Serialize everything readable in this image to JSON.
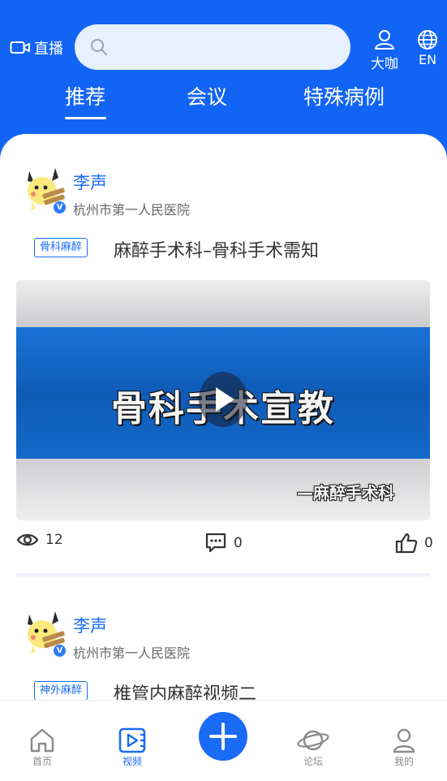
{
  "header": {
    "live_label": "直播",
    "search_placeholder": "",
    "dk_label": "大咖",
    "lang_label": "EN"
  },
  "tabs": [
    {
      "label": "推荐",
      "active": true
    },
    {
      "label": "会议",
      "active": false
    },
    {
      "label": "特殊病例",
      "active": false
    }
  ],
  "feed": [
    {
      "author": "李声",
      "verified_mark": "V",
      "hospital": "杭州市第一人民医院",
      "tag": "骨科麻醉",
      "title": "麻醉手术科–骨科手术需知",
      "video_caption": "骨科手术宣教",
      "video_subcaption": "—麻醉手术科",
      "views": "12",
      "comments": "0",
      "likes": "0"
    },
    {
      "author": "李声",
      "verified_mark": "V",
      "hospital": "杭州市第一人民医院",
      "tag": "神外麻醉",
      "title": "椎管内麻醉视频二"
    }
  ],
  "bottom_nav": [
    {
      "label": "首页",
      "icon": "home-icon",
      "active": false
    },
    {
      "label": "视频",
      "icon": "video-icon",
      "active": true
    },
    {
      "label": "",
      "icon": "plus-icon",
      "active": false
    },
    {
      "label": "论坛",
      "icon": "planet-icon",
      "active": false
    },
    {
      "label": "我的",
      "icon": "user-icon",
      "active": false
    }
  ],
  "colors": {
    "brand": "#1264f4",
    "accent": "#1a6bf5",
    "video_band": "#1262c8"
  }
}
